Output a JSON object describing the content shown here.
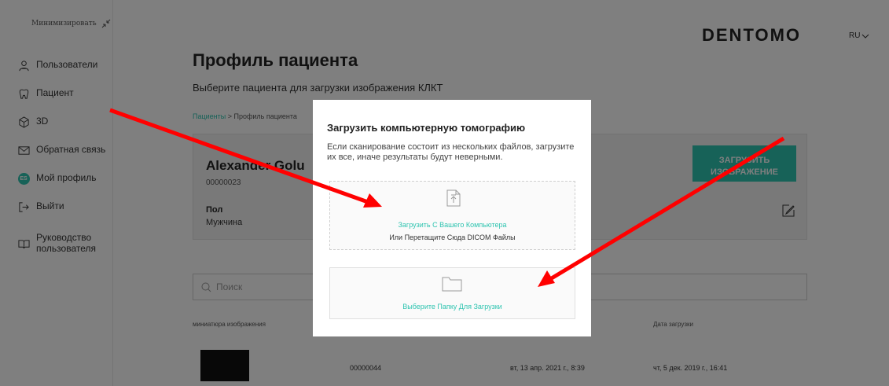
{
  "sidebar": {
    "minimize_label": "Минимизировать",
    "items": [
      {
        "label": "Пользователи",
        "icon": "users-icon"
      },
      {
        "label": "Пациент",
        "icon": "tooth-icon"
      },
      {
        "label": "3D",
        "icon": "cube-icon"
      },
      {
        "label": "Обратная связь",
        "icon": "mail-icon"
      },
      {
        "label": "Мой профиль",
        "icon": "avatar",
        "avatar_initials": "ES"
      },
      {
        "label": "Выйти",
        "icon": "logout-icon"
      },
      {
        "label": "Руководство пользователя",
        "icon": "book-icon"
      }
    ]
  },
  "header": {
    "logo": "DENTOMO",
    "lang": "RU"
  },
  "page": {
    "title": "Профиль пациента",
    "subtitle": "Выберите пациента для загрузки изображения КЛКТ",
    "breadcrumb_link": "Пациенты",
    "breadcrumb_sep": " > ",
    "breadcrumb_current": "Профиль пациента"
  },
  "patient": {
    "name": "Alexander Golu",
    "id": "00000023",
    "sex_label": "Пол",
    "sex_value": "Мужчина",
    "upload_button": "ЗАГРУЗИТЬ ИЗОБРАЖЕНИЕ"
  },
  "search": {
    "placeholder": "Поиск"
  },
  "table": {
    "headers": {
      "thumbnail": "миниатюра изображения",
      "uploaded": "Дата загрузки"
    },
    "row": {
      "id": "00000044",
      "date1": "вт, 13 апр. 2021 г., 8:39",
      "date2": "чт, 5 дек. 2019 г., 16:41"
    }
  },
  "modal": {
    "title": "Загрузить компьютерную томографию",
    "note": "Если сканирование состоит из нескольких файлов, загрузите их все, иначе результаты будут неверными.",
    "upload_link": "Загрузить С Вашего Компьютера",
    "drop_hint": "Или Перетащите Сюда DICOM Файлы",
    "folder_link": "Выберите Папку Для Загрузки"
  },
  "colors": {
    "accent": "#2ec4b0",
    "annotation_arrow": "#ff0000"
  }
}
